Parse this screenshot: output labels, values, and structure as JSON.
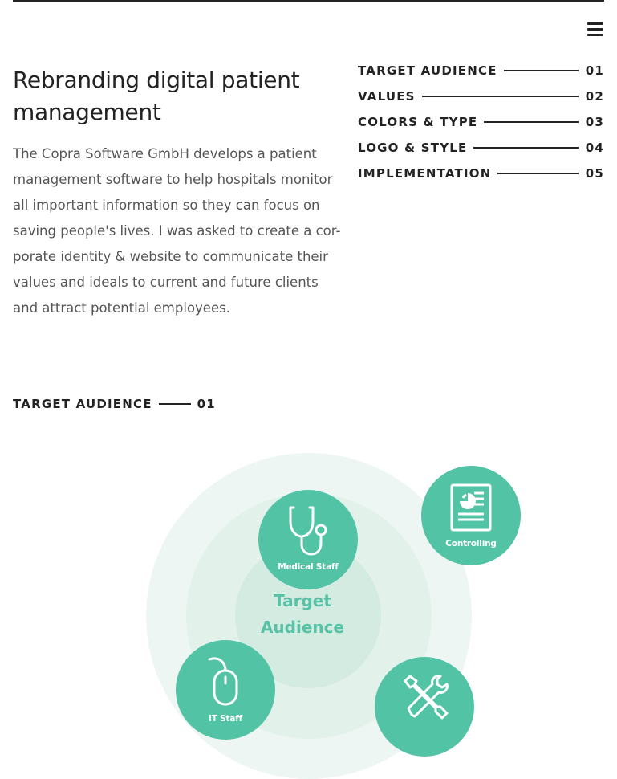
{
  "header": {
    "menu_icon": "hamburger-menu-icon"
  },
  "intro": {
    "title": "Rebranding digital patient management",
    "description": "The Copra Software GmbH develops a patient management software to help hospitals monitor all important information so they can focus on saving people's lives. I was asked to create a cor-porate identity & website to communicate their values and ideals to current and future clients and attract potential employees."
  },
  "toc": {
    "items": [
      {
        "label": "TARGET AUDIENCE",
        "number": "01"
      },
      {
        "label": "VALUES",
        "number": "02"
      },
      {
        "label": "COLORS & TYPE",
        "number": "03"
      },
      {
        "label": "LOGO & STYLE",
        "number": "04"
      },
      {
        "label": "IMPLEMENTATION",
        "number": "05"
      }
    ]
  },
  "section": {
    "label": "TARGET AUDIENCE",
    "number": "01"
  },
  "diagram": {
    "center_line1": "Target",
    "center_line2": "Audience",
    "accent_color": "#52c3a5",
    "ring_colors": [
      "#edf6f2",
      "#e2f2eb",
      "#d3ebe1"
    ],
    "bubbles": [
      {
        "label": "Medical Staff",
        "icon": "stethoscope-icon"
      },
      {
        "label": "Controlling",
        "icon": "report-chart-icon"
      },
      {
        "label": "IT Staff",
        "icon": "computer-mouse-icon"
      },
      {
        "label": "",
        "icon": "tools-icon"
      }
    ]
  }
}
